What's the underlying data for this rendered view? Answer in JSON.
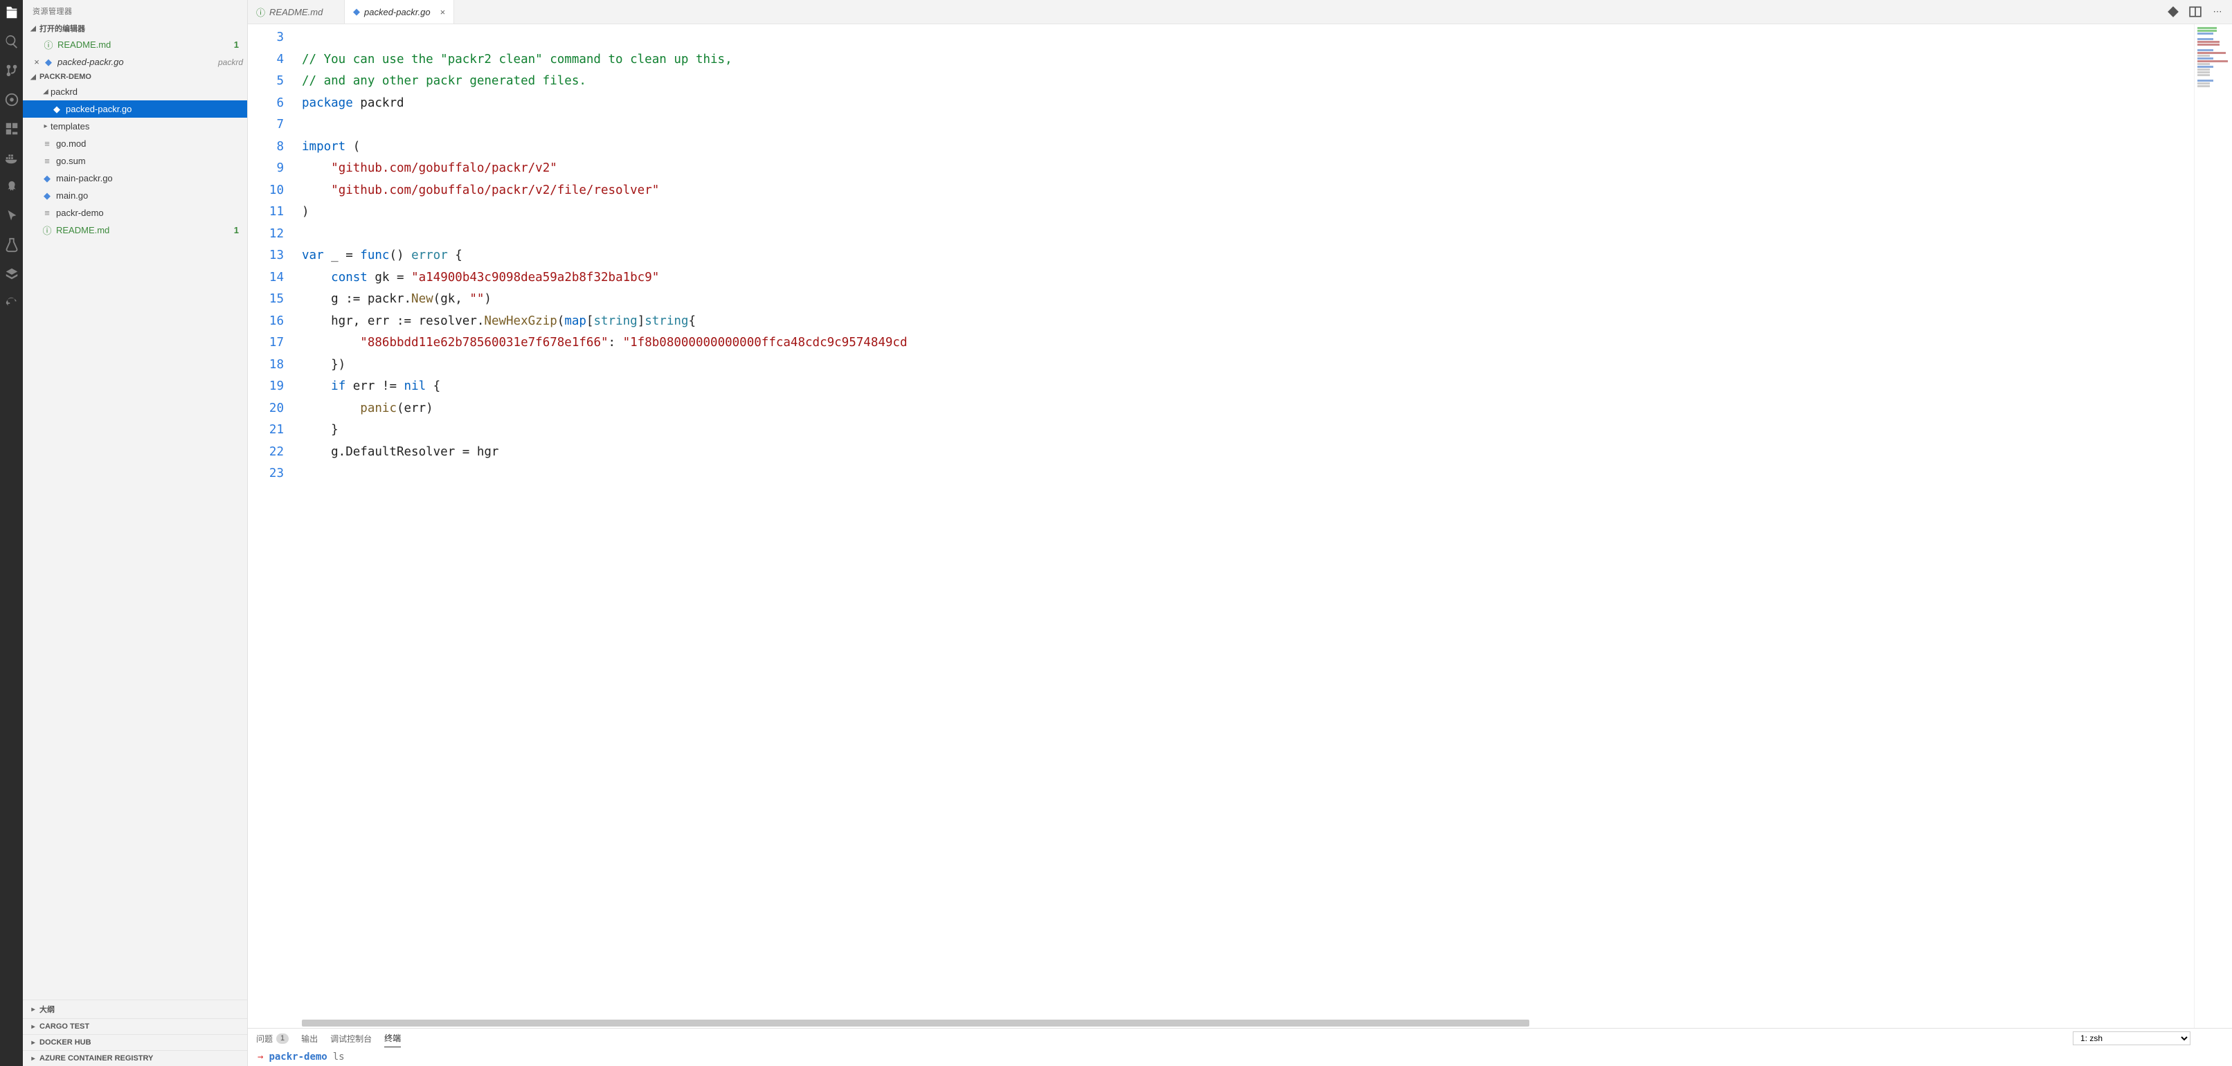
{
  "sidebar": {
    "title": "资源管理器",
    "openEditors": {
      "label": "打开的编辑器",
      "items": [
        {
          "name": "README.md",
          "icon": "info",
          "badge": "1",
          "close": ""
        },
        {
          "name": "packed-packr.go",
          "path": "packrd",
          "icon": "go",
          "close": "×"
        }
      ]
    },
    "project": {
      "label": "PACKR-DEMO",
      "tree": [
        {
          "type": "folder",
          "name": "packrd",
          "expanded": true,
          "depth": 0
        },
        {
          "type": "file",
          "name": "packed-packr.go",
          "icon": "go",
          "depth": 1,
          "selected": true
        },
        {
          "type": "folder",
          "name": "templates",
          "expanded": false,
          "depth": 0
        },
        {
          "type": "file",
          "name": "go.mod",
          "icon": "lines",
          "depth": 0
        },
        {
          "type": "file",
          "name": "go.sum",
          "icon": "lines",
          "depth": 0
        },
        {
          "type": "file",
          "name": "main-packr.go",
          "icon": "go",
          "depth": 0
        },
        {
          "type": "file",
          "name": "main.go",
          "icon": "go",
          "depth": 0
        },
        {
          "type": "file",
          "name": "packr-demo",
          "icon": "lines",
          "depth": 0
        },
        {
          "type": "file",
          "name": "README.md",
          "icon": "info",
          "depth": 0,
          "badge": "1",
          "infoStyle": true
        }
      ]
    },
    "bottom": [
      "大纲",
      "CARGO TEST",
      "DOCKER HUB",
      "AZURE CONTAINER REGISTRY"
    ]
  },
  "tabs": [
    {
      "label": "README.md",
      "icon": "info",
      "active": false,
      "close": ""
    },
    {
      "label": "packed-packr.go",
      "icon": "go",
      "active": true,
      "close": "×"
    }
  ],
  "code": {
    "startLine": 3,
    "lines": [
      {
        "n": 3,
        "html": ""
      },
      {
        "n": 4,
        "html": "<span class='cmt'>// You can use the \"packr2 clean\" command to clean up this,</span>"
      },
      {
        "n": 5,
        "html": "<span class='cmt'>// and any other packr generated files.</span>"
      },
      {
        "n": 6,
        "html": "<span class='k'>package</span> packrd"
      },
      {
        "n": 7,
        "html": ""
      },
      {
        "n": 8,
        "html": "<span class='k'>import</span> ("
      },
      {
        "n": 9,
        "html": "    <span class='str'>\"github.com/gobuffalo/packr/v2\"</span>"
      },
      {
        "n": 10,
        "html": "    <span class='str'>\"github.com/gobuffalo/packr/v2/file/resolver\"</span>"
      },
      {
        "n": 11,
        "html": ")"
      },
      {
        "n": 12,
        "html": ""
      },
      {
        "n": 13,
        "html": "<span class='k'>var</span> _ = <span class='k'>func</span>() <span class='typ'>error</span> {"
      },
      {
        "n": 14,
        "html": "    <span class='k'>const</span> gk = <span class='str'>\"a14900b43c9098dea59a2b8f32ba1bc9\"</span>"
      },
      {
        "n": 15,
        "html": "    g := packr.<span class='fn'>New</span>(gk, <span class='str'>\"\"</span>)"
      },
      {
        "n": 16,
        "html": "    hgr, err := resolver.<span class='fn'>NewHexGzip</span>(<span class='k'>map</span>[<span class='typ'>string</span>]<span class='typ'>string</span>{"
      },
      {
        "n": 17,
        "html": "        <span class='str'>\"886bbdd11e62b78560031e7f678e1f66\"</span>: <span class='str'>\"1f8b08000000000000ffca48cdc9c9574849cd</span>"
      },
      {
        "n": 18,
        "html": "    })"
      },
      {
        "n": 19,
        "html": "    <span class='k'>if</span> err != <span class='k'>nil</span> {"
      },
      {
        "n": 20,
        "html": "        <span class='fn'>panic</span>(err)"
      },
      {
        "n": 21,
        "html": "    }"
      },
      {
        "n": 22,
        "html": "    g.DefaultResolver = hgr"
      },
      {
        "n": 23,
        "html": ""
      }
    ]
  },
  "panel": {
    "tabs": {
      "problems": "问题",
      "problemsCount": "1",
      "output": "输出",
      "debug": "调试控制台",
      "terminal": "终端"
    },
    "termSelect": "1: zsh",
    "prompt": {
      "arrow": "→",
      "cwd": "packr-demo",
      "cmd": "ls"
    }
  }
}
